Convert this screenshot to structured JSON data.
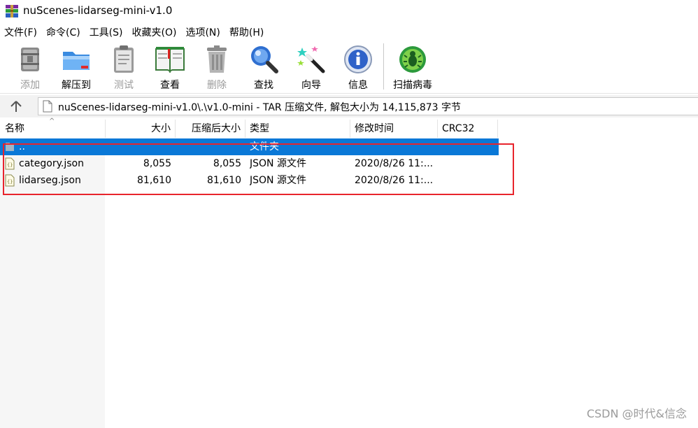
{
  "window": {
    "title": "nuScenes-lidarseg-mini-v1.0",
    "app_icon": "winrar-icon"
  },
  "menu": [
    {
      "label": "文件(F)"
    },
    {
      "label": "命令(C)"
    },
    {
      "label": "工具(S)"
    },
    {
      "label": "收藏夹(O)"
    },
    {
      "label": "选项(N)"
    },
    {
      "label": "帮助(H)"
    }
  ],
  "toolbar": [
    {
      "label": "添加",
      "icon": "add-archive-icon",
      "enabled": false
    },
    {
      "label": "解压到",
      "icon": "extract-folder-icon",
      "enabled": true
    },
    {
      "label": "测试",
      "icon": "test-clipboard-icon",
      "enabled": false
    },
    {
      "label": "查看",
      "icon": "view-book-icon",
      "enabled": true
    },
    {
      "label": "删除",
      "icon": "trash-icon",
      "enabled": false
    },
    {
      "label": "查找",
      "icon": "magnifier-icon",
      "enabled": true
    },
    {
      "label": "向导",
      "icon": "wizard-wand-icon",
      "enabled": true
    },
    {
      "label": "信息",
      "icon": "info-icon",
      "enabled": true
    },
    {
      "label": "扫描病毒",
      "icon": "virus-scan-icon",
      "enabled": true
    }
  ],
  "address": {
    "path": "nuScenes-lidarseg-mini-v1.0\\.\\v1.0-mini - TAR 压缩文件, 解包大小为 14,115,873 字节"
  },
  "columns": {
    "name": "名称",
    "size": "大小",
    "packed": "压缩后大小",
    "type": "类型",
    "modified": "修改时间",
    "crc": "CRC32"
  },
  "rows": [
    {
      "name": "..",
      "size": "",
      "packed": "",
      "type": "文件夹",
      "modified": "",
      "crc": "",
      "selected": true,
      "icon": "folder-up-icon"
    },
    {
      "name": "category.json",
      "size": "8,055",
      "packed": "8,055",
      "type": "JSON 源文件",
      "modified": "2020/8/26 11:...",
      "crc": "",
      "selected": false,
      "icon": "json-file-icon"
    },
    {
      "name": "lidarseg.json",
      "size": "81,610",
      "packed": "81,610",
      "type": "JSON 源文件",
      "modified": "2020/8/26 11:...",
      "crc": "",
      "selected": false,
      "icon": "json-file-icon"
    }
  ],
  "watermark": "CSDN @时代&信念",
  "colors": {
    "selection": "#0a78d7",
    "annotation_box": "#e8242c",
    "disabled_text": "#9a9a9a"
  }
}
